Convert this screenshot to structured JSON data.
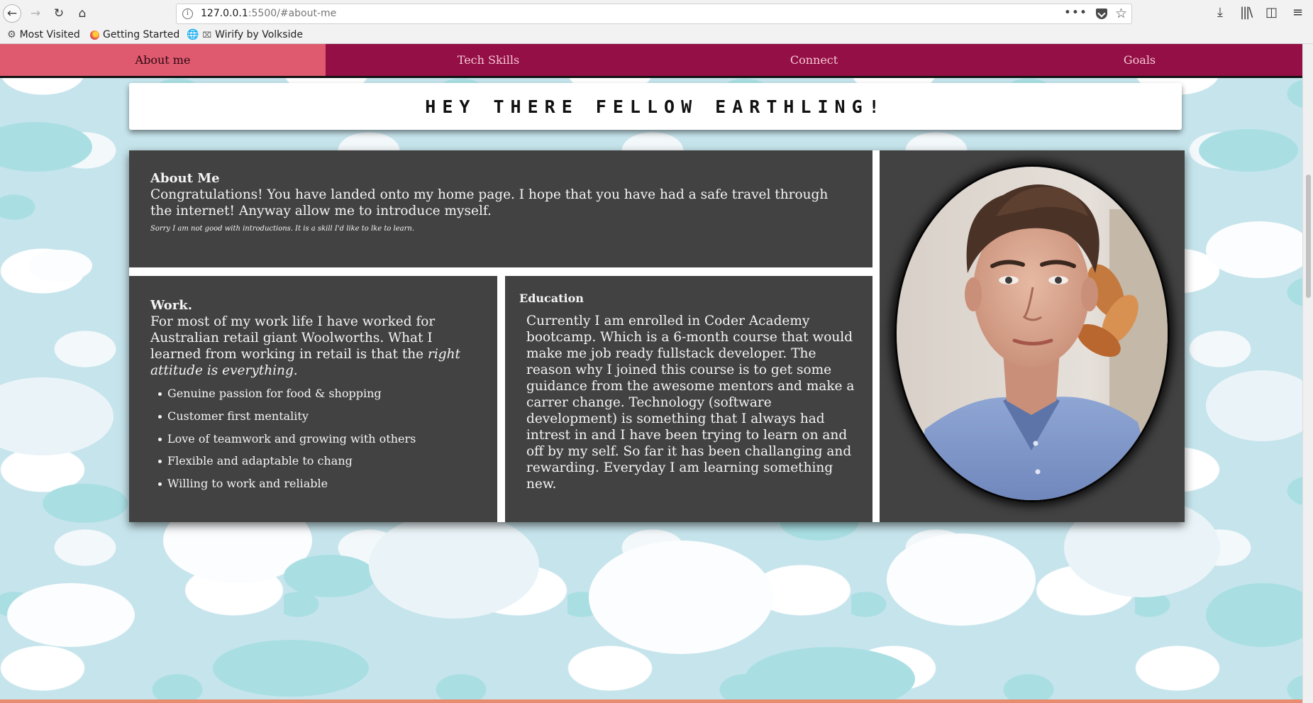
{
  "browser": {
    "url_host": "127.0.0.1",
    "url_rest": ":5500/#about-me",
    "bookmarks": [
      "Most Visited",
      "Getting Started",
      "Wirify by Volkside"
    ]
  },
  "nav": {
    "tabs": [
      "About me",
      "Tech Skills",
      "Connect",
      "Goals"
    ],
    "active": "About me"
  },
  "banner": {
    "title": "Hey there fellow earthling!"
  },
  "about": {
    "heading": "About Me",
    "text": "Congratulations! You have landed onto my home page. I hope that you have had a safe travel through the internet! Anyway allow me to introduce myself.",
    "note": "Sorry I am not good with introductions. It is a skill I'd like to lke to learn."
  },
  "work": {
    "heading": "Work.",
    "text_before": "For most of my work life I have worked for Australian retail giant Woolworths. What I learned from working in retail is that the ",
    "text_emphasis": "right attitude is everything.",
    "items": [
      "Genuine passion for food & shopping",
      "Customer first mentality",
      "Love of teamwork and growing with others",
      "Flexible and adaptable to chang",
      "Willing to work and reliable"
    ]
  },
  "education": {
    "heading": "Education",
    "text": "Currently I am enrolled in Coder Academy bootcamp. Which is a 6-month course that would make me job ready fullstack developer. The reason why I joined this course is to get some guidance from the awesome mentors and make a carrer change. Technology (software development) is something that I always had intrest in and I have been trying to learn on and off by my self. So far it has been challanging and rewarding. Everyday I am learning something new."
  },
  "colors": {
    "nav_bg": "#930f45",
    "nav_active": "#df596f",
    "panel_bg": "#424242",
    "sky": "#c6e4ec"
  },
  "icons": [
    "back-arrow-icon",
    "forward-arrow-icon",
    "reload-icon",
    "home-icon",
    "info-icon",
    "more-icon",
    "pocket-icon",
    "star-icon",
    "download-icon",
    "library-icon",
    "sidebar-icon",
    "menu-icon",
    "gear-icon",
    "firefox-icon",
    "globe-icon"
  ]
}
